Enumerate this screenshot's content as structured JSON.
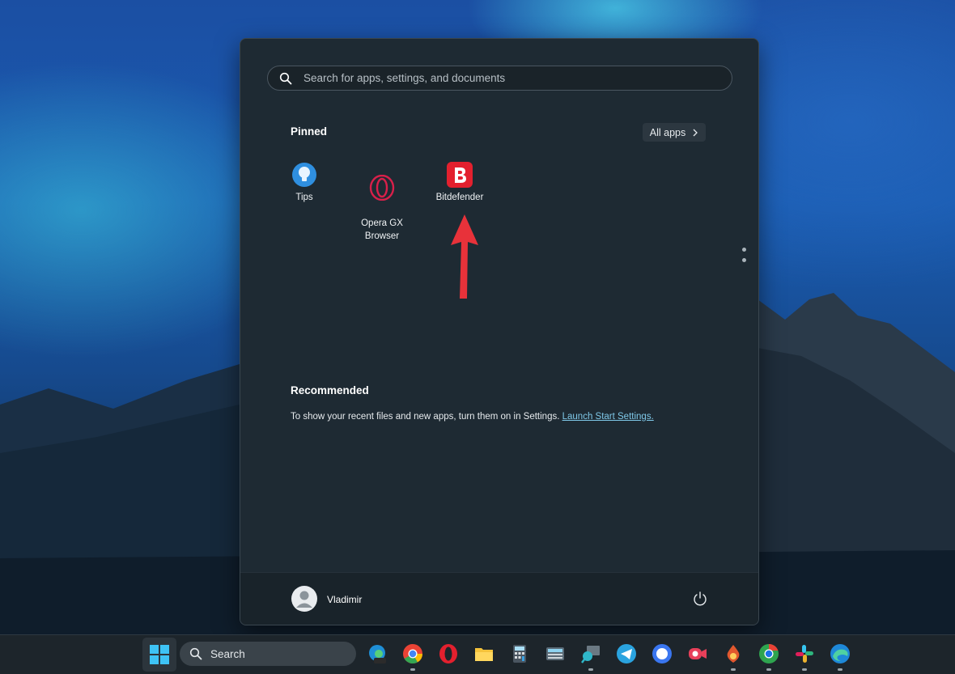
{
  "start_menu": {
    "search_placeholder": "Search for apps, settings, and documents",
    "pinned": {
      "title": "Pinned",
      "all_apps_label": "All apps",
      "apps": [
        {
          "label": "Tips",
          "icon": "tips-lightbulb-icon"
        },
        {
          "label": "Opera GX\nBrowser",
          "icon": "opera-gx-icon"
        },
        {
          "label": "Bitdefender",
          "icon": "bitdefender-icon"
        }
      ]
    },
    "recommended": {
      "title": "Recommended",
      "message": "To show your recent files and new apps, turn them on in Settings.",
      "link_label": "Launch Start Settings."
    },
    "user": {
      "name": "Vladimir"
    },
    "accent_arrow_color": "#e8323a"
  },
  "taskbar": {
    "search_label": "Search",
    "apps": [
      "edge-preview-icon",
      "chrome-icon",
      "opera-icon",
      "file-explorer-icon",
      "calculator-icon",
      "touch-keyboard-icon",
      "magnifier-icon",
      "telegram-icon",
      "signal-icon",
      "screen-recorder-icon",
      "game-icon",
      "chromium-icon",
      "slack-icon",
      "edge-icon"
    ]
  }
}
